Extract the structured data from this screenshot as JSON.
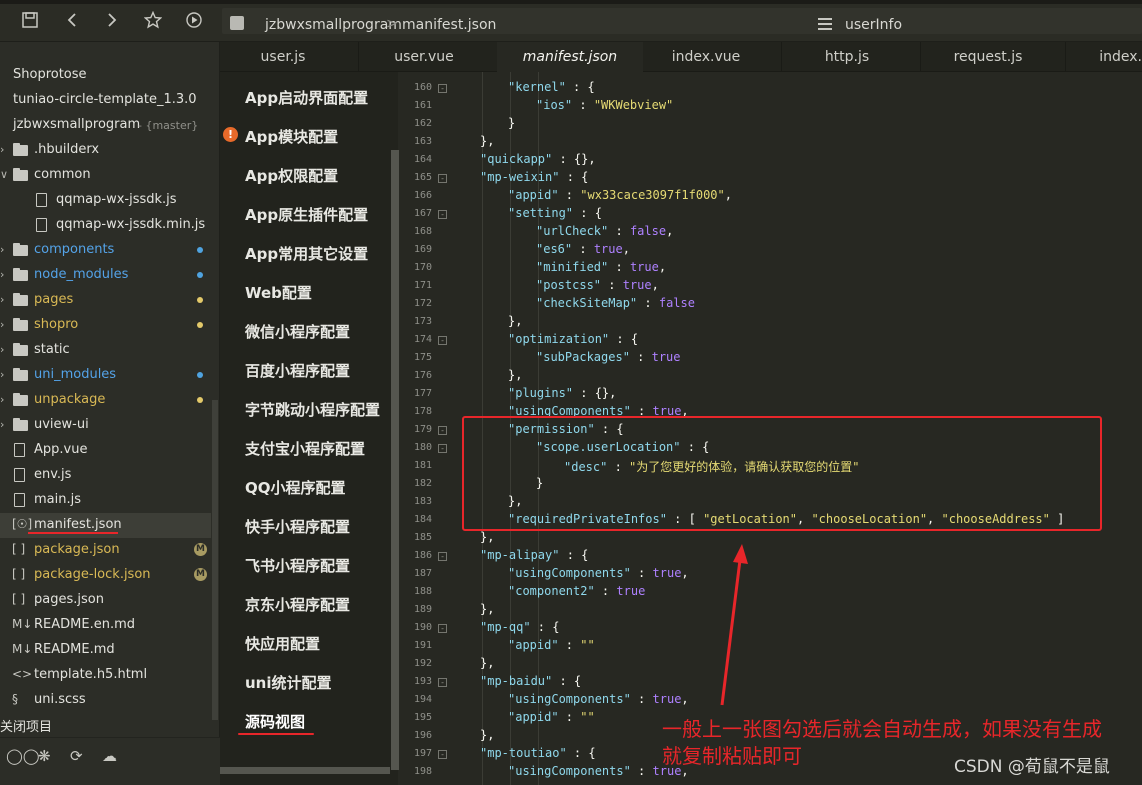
{
  "breadcrumb": {
    "project": "jzbwxsmallprogram",
    "separator": ">",
    "file": "manifest.json"
  },
  "outline": {
    "label": "userInfo"
  },
  "tabs": [
    {
      "label": "user.js"
    },
    {
      "label": "user.vue"
    },
    {
      "label": "manifest.json",
      "active": true
    },
    {
      "label": "index.vue"
    },
    {
      "label": "http.js"
    },
    {
      "label": "request.js"
    },
    {
      "label": "index."
    }
  ],
  "sidebar": {
    "items": [
      {
        "label": "Shoprotose",
        "type": "project"
      },
      {
        "label": "tuniao-circle-template_1.3.0",
        "type": "project"
      },
      {
        "label": "jzbwxsmallprogram",
        "type": "project",
        "suffix": "- {master}"
      },
      {
        "label": ".hbuilderx",
        "type": "folder"
      },
      {
        "label": "common",
        "type": "folder-open"
      },
      {
        "label": "qqmap-wx-jssdk.js",
        "type": "file"
      },
      {
        "label": "qqmap-wx-jssdk.min.js",
        "type": "file"
      },
      {
        "label": "components",
        "type": "folder",
        "color": "blue",
        "dot": "#4fa3e0"
      },
      {
        "label": "node_modules",
        "type": "folder",
        "color": "blue",
        "dot": "#4fa3e0"
      },
      {
        "label": "pages",
        "type": "folder",
        "color": "yellow",
        "dot": "#e3c96a"
      },
      {
        "label": "shopro",
        "type": "folder",
        "color": "yellow",
        "dot": "#e3c96a"
      },
      {
        "label": "static",
        "type": "folder"
      },
      {
        "label": "uni_modules",
        "type": "folder",
        "color": "blue",
        "dot": "#4fa3e0"
      },
      {
        "label": "unpackage",
        "type": "folder",
        "color": "yellow",
        "dot": "#e3c96a"
      },
      {
        "label": "uview-ui",
        "type": "folder"
      },
      {
        "label": "App.vue",
        "type": "file"
      },
      {
        "label": "env.js",
        "type": "file"
      },
      {
        "label": "main.js",
        "type": "file"
      },
      {
        "label": "manifest.json",
        "type": "json-cfg",
        "selected": true
      },
      {
        "label": "package.json",
        "type": "json",
        "color": "yellow",
        "badge": "M"
      },
      {
        "label": "package-lock.json",
        "type": "json",
        "color": "yellow",
        "badge": "M"
      },
      {
        "label": "pages.json",
        "type": "json"
      },
      {
        "label": "README.en.md",
        "type": "md"
      },
      {
        "label": "README.md",
        "type": "md"
      },
      {
        "label": "template.h5.html",
        "type": "html"
      },
      {
        "label": "uni.scss",
        "type": "scss"
      }
    ],
    "recent": "关闭项目"
  },
  "config_nav": {
    "items": [
      {
        "label": "App启动界面配置"
      },
      {
        "label": "App模块配置",
        "warning": "!"
      },
      {
        "label": "App权限配置"
      },
      {
        "label": "App原生插件配置"
      },
      {
        "label": "App常用其它设置"
      },
      {
        "label": "Web配置"
      },
      {
        "label": "微信小程序配置"
      },
      {
        "label": "百度小程序配置"
      },
      {
        "label": "字节跳动小程序配置"
      },
      {
        "label": "支付宝小程序配置"
      },
      {
        "label": "QQ小程序配置"
      },
      {
        "label": "快手小程序配置"
      },
      {
        "label": "飞书小程序配置"
      },
      {
        "label": "京东小程序配置"
      },
      {
        "label": "快应用配置"
      },
      {
        "label": "uni统计配置"
      },
      {
        "label": "源码视图",
        "active": true
      }
    ]
  },
  "editor": {
    "lines": [
      {
        "n": "160",
        "fold": "-",
        "indent": 1,
        "parts": [
          [
            "key",
            "\"kernel\""
          ],
          [
            "p",
            " : {"
          ]
        ]
      },
      {
        "n": "161",
        "indent": 2,
        "parts": [
          [
            "key",
            "\"ios\""
          ],
          [
            "p",
            " : "
          ],
          [
            "str",
            "\"WKWebview\""
          ]
        ]
      },
      {
        "n": "162",
        "indent": 1,
        "parts": [
          [
            "p",
            "}"
          ]
        ]
      },
      {
        "n": "163",
        "indent": 0,
        "parts": [
          [
            "p",
            "},"
          ]
        ]
      },
      {
        "n": "164",
        "indent": 0,
        "parts": [
          [
            "key",
            "\"quickapp\""
          ],
          [
            "p",
            " : {},"
          ]
        ]
      },
      {
        "n": "165",
        "fold": "-",
        "indent": 0,
        "parts": [
          [
            "key",
            "\"mp-weixin\""
          ],
          [
            "p",
            " : {"
          ]
        ]
      },
      {
        "n": "166",
        "indent": 1,
        "parts": [
          [
            "key",
            "\"appid\""
          ],
          [
            "p",
            " : "
          ],
          [
            "str",
            "\"wx33cace3097f1f000\""
          ],
          [
            "p",
            ","
          ]
        ]
      },
      {
        "n": "167",
        "fold": "-",
        "indent": 1,
        "parts": [
          [
            "key",
            "\"setting\""
          ],
          [
            "p",
            " : {"
          ]
        ]
      },
      {
        "n": "168",
        "indent": 2,
        "parts": [
          [
            "key",
            "\"urlCheck\""
          ],
          [
            "p",
            " : "
          ],
          [
            "kw",
            "false"
          ],
          [
            "p",
            ","
          ]
        ]
      },
      {
        "n": "169",
        "indent": 2,
        "parts": [
          [
            "key",
            "\"es6\""
          ],
          [
            "p",
            " : "
          ],
          [
            "kw",
            "true"
          ],
          [
            "p",
            ","
          ]
        ]
      },
      {
        "n": "170",
        "indent": 2,
        "parts": [
          [
            "key",
            "\"minified\""
          ],
          [
            "p",
            " : "
          ],
          [
            "kw",
            "true"
          ],
          [
            "p",
            ","
          ]
        ]
      },
      {
        "n": "171",
        "indent": 2,
        "parts": [
          [
            "key",
            "\"postcss\""
          ],
          [
            "p",
            " : "
          ],
          [
            "kw",
            "true"
          ],
          [
            "p",
            ","
          ]
        ]
      },
      {
        "n": "172",
        "indent": 2,
        "parts": [
          [
            "key",
            "\"checkSiteMap\""
          ],
          [
            "p",
            " : "
          ],
          [
            "kw",
            "false"
          ]
        ]
      },
      {
        "n": "173",
        "indent": 1,
        "parts": [
          [
            "p",
            "},"
          ]
        ]
      },
      {
        "n": "174",
        "fold": "-",
        "indent": 1,
        "parts": [
          [
            "key",
            "\"optimization\""
          ],
          [
            "p",
            " : {"
          ]
        ]
      },
      {
        "n": "175",
        "indent": 2,
        "parts": [
          [
            "key",
            "\"subPackages\""
          ],
          [
            "p",
            " : "
          ],
          [
            "kw",
            "true"
          ]
        ]
      },
      {
        "n": "176",
        "indent": 1,
        "parts": [
          [
            "p",
            "},"
          ]
        ]
      },
      {
        "n": "177",
        "indent": 1,
        "parts": [
          [
            "key",
            "\"plugins\""
          ],
          [
            "p",
            " : {},"
          ]
        ]
      },
      {
        "n": "178",
        "indent": 1,
        "parts": [
          [
            "key",
            "\"usingComponents\""
          ],
          [
            "p",
            " : "
          ],
          [
            "kw",
            "true"
          ],
          [
            "p",
            ","
          ]
        ]
      },
      {
        "n": "179",
        "fold": "-",
        "indent": 1,
        "parts": [
          [
            "key",
            "\"permission\""
          ],
          [
            "p",
            " : {"
          ]
        ]
      },
      {
        "n": "180",
        "fold": "-",
        "indent": 2,
        "parts": [
          [
            "key",
            "\"scope.userLocation\""
          ],
          [
            "p",
            " : {"
          ]
        ]
      },
      {
        "n": "181",
        "indent": 3,
        "parts": [
          [
            "key",
            "\"desc\""
          ],
          [
            "p",
            " : "
          ],
          [
            "str",
            "\"为了您更好的体验，请确认获取您的位置\""
          ]
        ]
      },
      {
        "n": "182",
        "indent": 2,
        "parts": [
          [
            "p",
            "}"
          ]
        ]
      },
      {
        "n": "183",
        "indent": 1,
        "parts": [
          [
            "p",
            "},"
          ]
        ]
      },
      {
        "n": "184",
        "indent": 1,
        "parts": [
          [
            "key",
            "\"requiredPrivateInfos\""
          ],
          [
            "p",
            " : [ "
          ],
          [
            "str",
            "\"getLocation\""
          ],
          [
            "p",
            ", "
          ],
          [
            "str",
            "\"chooseLocation\""
          ],
          [
            "p",
            ", "
          ],
          [
            "str",
            "\"chooseAddress\""
          ],
          [
            "p",
            " ]"
          ]
        ]
      },
      {
        "n": "185",
        "indent": 0,
        "parts": [
          [
            "p",
            "},"
          ]
        ]
      },
      {
        "n": "186",
        "fold": "-",
        "indent": 0,
        "parts": [
          [
            "key",
            "\"mp-alipay\""
          ],
          [
            "p",
            " : {"
          ]
        ]
      },
      {
        "n": "187",
        "indent": 1,
        "parts": [
          [
            "key",
            "\"usingComponents\""
          ],
          [
            "p",
            " : "
          ],
          [
            "kw",
            "true"
          ],
          [
            "p",
            ","
          ]
        ]
      },
      {
        "n": "188",
        "indent": 1,
        "parts": [
          [
            "key",
            "\"component2\""
          ],
          [
            "p",
            " : "
          ],
          [
            "kw",
            "true"
          ]
        ]
      },
      {
        "n": "189",
        "indent": 0,
        "parts": [
          [
            "p",
            "},"
          ]
        ]
      },
      {
        "n": "190",
        "fold": "-",
        "indent": 0,
        "parts": [
          [
            "key",
            "\"mp-qq\""
          ],
          [
            "p",
            " : {"
          ]
        ]
      },
      {
        "n": "191",
        "indent": 1,
        "parts": [
          [
            "key",
            "\"appid\""
          ],
          [
            "p",
            " : "
          ],
          [
            "str",
            "\"\""
          ]
        ]
      },
      {
        "n": "192",
        "indent": 0,
        "parts": [
          [
            "p",
            "},"
          ]
        ]
      },
      {
        "n": "193",
        "fold": "-",
        "indent": 0,
        "parts": [
          [
            "key",
            "\"mp-baidu\""
          ],
          [
            "p",
            " : {"
          ]
        ]
      },
      {
        "n": "194",
        "indent": 1,
        "parts": [
          [
            "key",
            "\"usingComponents\""
          ],
          [
            "p",
            " : "
          ],
          [
            "kw",
            "true"
          ],
          [
            "p",
            ","
          ]
        ]
      },
      {
        "n": "195",
        "indent": 1,
        "parts": [
          [
            "key",
            "\"appid\""
          ],
          [
            "p",
            " : "
          ],
          [
            "str",
            "\"\""
          ]
        ]
      },
      {
        "n": "196",
        "indent": 0,
        "parts": [
          [
            "p",
            "},"
          ]
        ]
      },
      {
        "n": "197",
        "fold": "-",
        "indent": 0,
        "parts": [
          [
            "key",
            "\"mp-toutiao\""
          ],
          [
            "p",
            " : {"
          ]
        ]
      },
      {
        "n": "198",
        "indent": 1,
        "parts": [
          [
            "key",
            "\"usingComponents\""
          ],
          [
            "p",
            " : "
          ],
          [
            "kw",
            "true"
          ],
          [
            "p",
            ","
          ]
        ]
      }
    ]
  },
  "annotation": {
    "line1": "一般上一张图勾选后就会自动生成，如果没有生成",
    "line2": "就复制粘贴即可",
    "color": "#e8262a"
  },
  "watermark": "CSDN @荀鼠不是鼠",
  "icons": {
    "save": "save-icon",
    "back": "arrow-left-icon",
    "forward": "arrow-right-icon",
    "star": "star-icon",
    "run": "run-icon",
    "outline": "outline-icon"
  }
}
